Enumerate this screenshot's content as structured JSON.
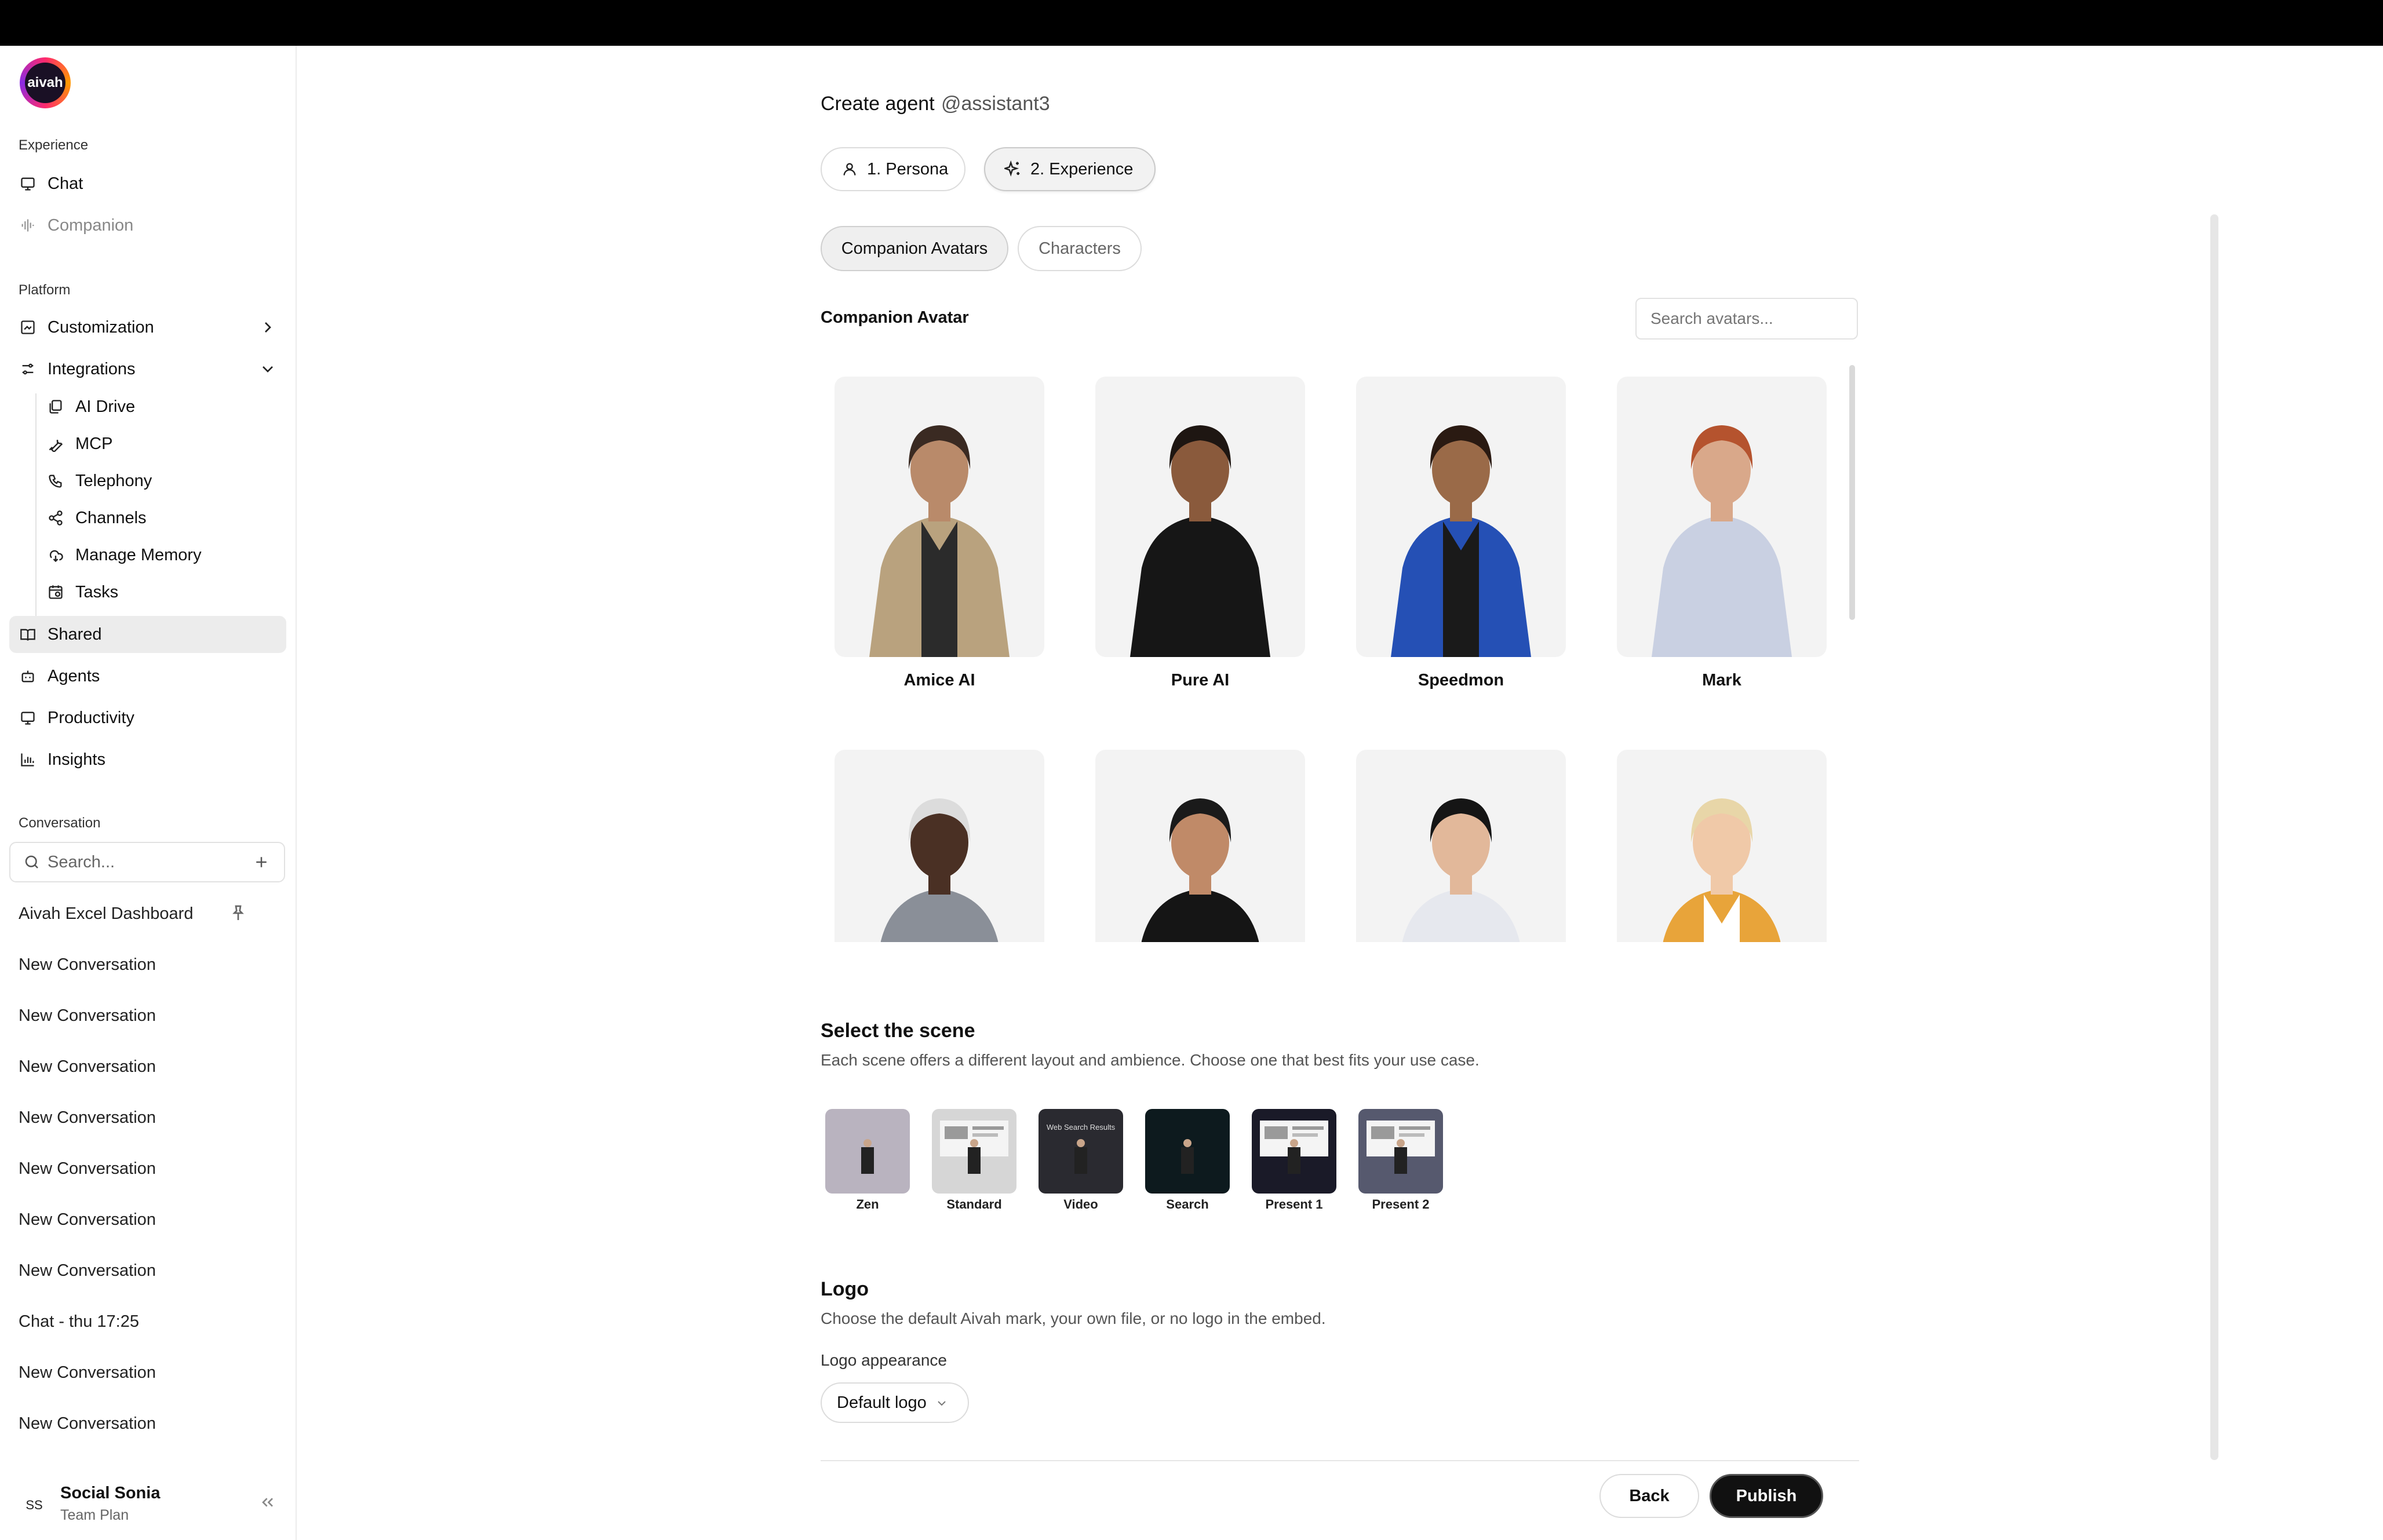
{
  "app": {
    "logo_text": "aivah"
  },
  "sidebar": {
    "experience_label": "Experience",
    "experience_items": [
      {
        "label": "Chat",
        "icon": "monitor-icon"
      },
      {
        "label": "Companion",
        "icon": "waveform-icon"
      }
    ],
    "platform_label": "Platform",
    "customization": {
      "label": "Customization",
      "icon": "image-edit-icon"
    },
    "integrations": {
      "label": "Integrations",
      "icon": "sliders-icon",
      "items": [
        {
          "label": "AI Drive",
          "icon": "files-icon"
        },
        {
          "label": "MCP",
          "icon": "wrench-icon"
        },
        {
          "label": "Telephony",
          "icon": "phone-icon"
        },
        {
          "label": "Channels",
          "icon": "share-icon"
        },
        {
          "label": "Manage Memory",
          "icon": "cloud-sync-icon"
        },
        {
          "label": "Tasks",
          "icon": "calendar-clock-icon"
        }
      ]
    },
    "main_items": [
      {
        "label": "Shared",
        "icon": "book-icon",
        "active": true
      },
      {
        "label": "Agents",
        "icon": "bot-icon"
      },
      {
        "label": "Productivity",
        "icon": "monitor-icon"
      },
      {
        "label": "Insights",
        "icon": "bar-chart-icon"
      }
    ],
    "conversation_label": "Conversation",
    "search_placeholder": "Search...",
    "conversations": [
      "Aivah Excel Dashboard",
      "New Conversation",
      "New Conversation",
      "New Conversation",
      "New Conversation",
      "New Conversation",
      "New Conversation",
      "New Conversation",
      "Chat - thu 17:25",
      "New Conversation",
      "New Conversation"
    ],
    "user": {
      "initials": "SS",
      "name": "Social Sonia",
      "plan": "Team Plan"
    }
  },
  "main": {
    "title": "Create agent",
    "handle": "@assistant3",
    "steps": [
      {
        "label": "1. Persona",
        "icon": "user-icon"
      },
      {
        "label": "2. Experience",
        "icon": "sparkles-icon",
        "selected": true
      }
    ],
    "subtabs": [
      {
        "label": "Companion Avatars",
        "selected": true
      },
      {
        "label": "Characters"
      }
    ],
    "section_label": "Companion Avatar",
    "search_placeholder": "Search avatars...",
    "avatars": [
      {
        "name": "Amice AI",
        "hair": "#3a2a22",
        "skin": "#b98a6a",
        "top": "#b9a27e",
        "inner": "#2b2b2b",
        "bottom": "#3a3a3a"
      },
      {
        "name": "Pure AI",
        "hair": "#1e1612",
        "skin": "#8a5a3c",
        "top": "#161616",
        "inner": "#161616",
        "bottom": "#2a3550"
      },
      {
        "name": "Speedmon",
        "hair": "#2a1a12",
        "skin": "#9a6a48",
        "top": "#2550b5",
        "inner": "#1a1a1a",
        "bottom": "#1b1b1b"
      },
      {
        "name": "Mark",
        "hair": "#b5532e",
        "skin": "#d9a88a",
        "top": "#c9d0e2",
        "inner": "#c9d0e2",
        "bottom": "#2f3548"
      },
      {
        "name": "",
        "hair": "#dcdcdc",
        "skin": "#4a3024",
        "top": "#8a8f98",
        "inner": "#8a8f98",
        "bottom": "#555"
      },
      {
        "name": "",
        "hair": "#1a1a1a",
        "skin": "#c08a68",
        "top": "#151515",
        "inner": "#151515",
        "bottom": "#222"
      },
      {
        "name": "",
        "hair": "#151515",
        "skin": "#e2b89a",
        "top": "#e6e8ee",
        "inner": "#e6e8ee",
        "bottom": "#ccc"
      },
      {
        "name": "",
        "hair": "#e8d6a8",
        "skin": "#f0c9a8",
        "top": "#e8a43a",
        "inner": "#ffffff",
        "bottom": "#ccc"
      }
    ],
    "scene": {
      "title": "Select the scene",
      "description": "Each scene offers a different layout and ambience. Choose one that best fits your use case.",
      "options": [
        {
          "label": "Zen",
          "bg": "#b9b3bf"
        },
        {
          "label": "Standard",
          "bg": "#d6d6d6"
        },
        {
          "label": "Video",
          "bg": "#2a2a30",
          "caption": "Web Search Results"
        },
        {
          "label": "Search",
          "bg": "#0d1a1e"
        },
        {
          "label": "Present 1",
          "bg": "#1a1a28"
        },
        {
          "label": "Present 2",
          "bg": "#56596e"
        }
      ]
    },
    "logo": {
      "title": "Logo",
      "description": "Choose the default Aivah mark, your own file, or no logo in the embed.",
      "field_label": "Logo appearance",
      "value": "Default logo"
    },
    "buttons": {
      "back": "Back",
      "publish": "Publish"
    }
  }
}
